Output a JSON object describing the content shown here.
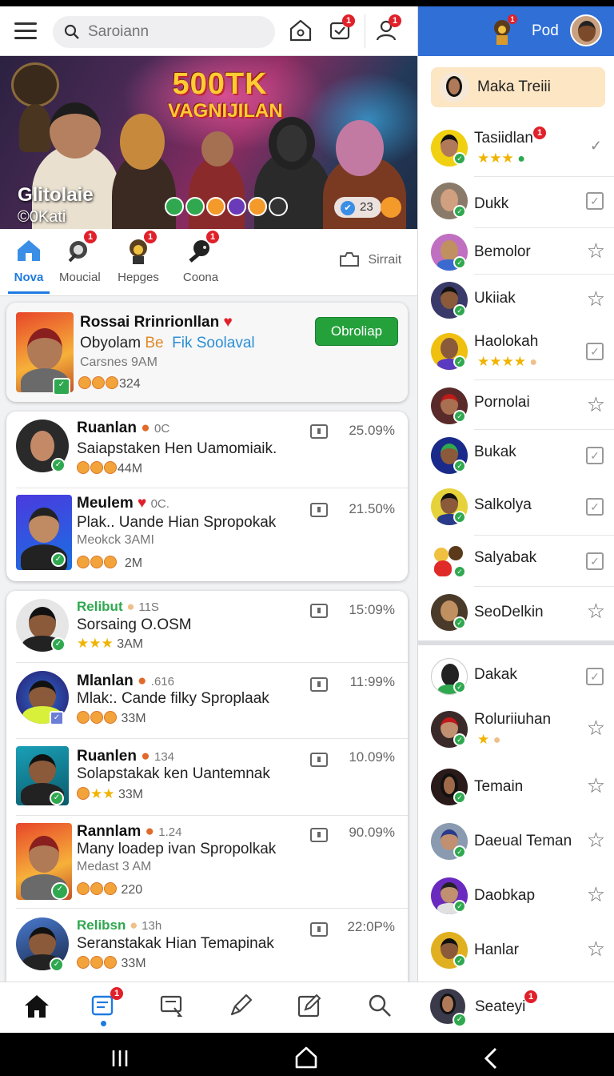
{
  "topbar": {
    "search_placeholder": "Saroiann",
    "notif_badge": "1",
    "profile_badge": "1"
  },
  "hero": {
    "title_line1": "500TK",
    "title_line2": "VAGNIJILAN",
    "name": "Glitolaie",
    "sub": "©0Kati",
    "count": "23"
  },
  "tabs": [
    {
      "label": "Nova",
      "badge": ""
    },
    {
      "label": "Moucial",
      "badge": "1"
    },
    {
      "label": "Hepges",
      "badge": "1"
    },
    {
      "label": "Coona",
      "badge": "1"
    }
  ],
  "saved_label": "Sirrait",
  "featured": {
    "name": "Rossai Rrinrionllan",
    "line_a": "Obyolam",
    "line_b": "Be",
    "line_c": "Fik Soolaval",
    "time": "Carsnes 9AM",
    "reactions": "324",
    "button": "Obroliap"
  },
  "feed": [
    {
      "name": "Ruanlan",
      "tag": "0C",
      "text": "Saiapstaken Hen Uamomiaik.",
      "meta": "",
      "reactions": "44M",
      "pct": "25.09%",
      "rating": "emoji"
    },
    {
      "name": "Meulem",
      "tag": "0C.",
      "text": "Plak.. Uande Hian Spropokak",
      "meta": "Meokck 3AMI",
      "reactions": "2M",
      "pct": "21.50%",
      "rating": "emoji"
    },
    {
      "name": "Relibut",
      "tag": "11S",
      "text": "Sorsaing O.OSM",
      "meta": "",
      "reactions": "3AM",
      "pct": "15:09%",
      "rating": "stars"
    },
    {
      "name": "Mlanlan",
      "tag": ".616",
      "text": "Mlak:. Cande filky Sproplaak",
      "meta": "",
      "reactions": "33M",
      "pct": "11:99%",
      "rating": "emoji"
    },
    {
      "name": "Ruanlen",
      "tag": "134",
      "text": "Solapstakak ken Uantemnak",
      "meta": "",
      "reactions": "33M",
      "pct": "10.09%",
      "rating": "mixed"
    },
    {
      "name": "Rannlam",
      "tag": "1.24",
      "text": "Many loadep ivan Spropolkak",
      "meta": "Medast 3 AM",
      "reactions": "220",
      "pct": "90.09%",
      "rating": "emoji"
    },
    {
      "name": "Relibsn",
      "tag": "13h",
      "text": "Seranstakak Hian Temapinak",
      "meta": "",
      "reactions": "33M",
      "pct": "22:0P%",
      "rating": "emoji"
    }
  ],
  "right": {
    "header_name": "Pod",
    "chip": "Maka Treiii",
    "friends": [
      {
        "name": "Tasiidlan",
        "control": "tick"
      },
      {
        "name": "Dukk",
        "control": "check"
      },
      {
        "name": "Bemolor",
        "control": "star"
      },
      {
        "name": "Ukiiak",
        "control": "star"
      },
      {
        "name": "Haolokah",
        "control": "check"
      },
      {
        "name": "Pornolai",
        "control": "star"
      },
      {
        "name": "Bukak",
        "control": "check"
      },
      {
        "name": "Salkolya",
        "control": "check"
      },
      {
        "name": "Salyabak",
        "control": "check"
      },
      {
        "name": "SeoDelkin",
        "control": "star"
      },
      {
        "name": "Dakak",
        "control": "check"
      },
      {
        "name": "Roluriiuhan",
        "control": "star"
      },
      {
        "name": "Temain",
        "control": "star"
      },
      {
        "name": "Daeual Teman",
        "control": "star"
      },
      {
        "name": "Daobkap",
        "control": "star"
      },
      {
        "name": "Hanlar",
        "control": "star"
      }
    ]
  },
  "bottom": {
    "badge": "1",
    "me_name": "Seateyi",
    "me_badge": "1"
  },
  "colors": {
    "accent": "#1f7ae0",
    "right_header": "#2f6fd6",
    "follow_green": "#25a13c",
    "badge_red": "#e0202a"
  }
}
